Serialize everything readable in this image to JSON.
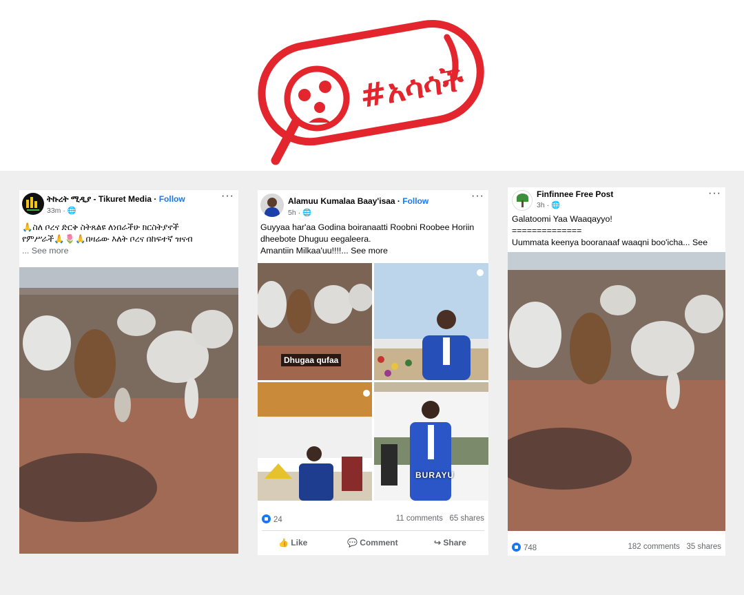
{
  "stamp": {
    "text": "#አሳሳች",
    "color": "#e3262e"
  },
  "posts": [
    {
      "page": "ትኩረት ሚዲያ - Tikuret Media",
      "follow": "Follow",
      "time": "33m",
      "caption_lines": [
        "🙏ስለ ቦረና ድርቅ ስትጸልዩ ለነበራችሁ ክርስትያኖች",
        "የምሥራች🙏🌷🙏በዛሬው እለት ቦረና በከፍተኛ ዝናብ",
        "... See more"
      ]
    },
    {
      "page": "Alamuu Kumalaa Baay'isaa",
      "follow": "Follow",
      "time": "5h",
      "caption_lines": [
        "Guyyaa har'aa Godina boiranaatti Roobni Roobee Horiin",
        "dheebote Dhuguu eegaleera.",
        "Amantiin Milkaa'uu!!!!... See more"
      ],
      "overlay_text": "Dhugaa qufaa",
      "banner_text": "BURAYU",
      "reactions": "24",
      "comments": "11 comments",
      "shares": "65 shares",
      "actions": {
        "like": "Like",
        "comment": "Comment",
        "share": "Share"
      }
    },
    {
      "page": "Finfinnee Free Post",
      "time": "3h",
      "caption_lines": [
        "Galatoomi Yaa Waaqayyo!",
        "==============",
        "Uummata keenya booranaaf waaqni boo'icha... See more"
      ],
      "reactions": "748",
      "comments": "182 comments",
      "shares": "35 shares"
    }
  ],
  "colors": {
    "facebook_blue": "#1877f2",
    "muted_text": "#65676b",
    "band": "#efeff0"
  }
}
